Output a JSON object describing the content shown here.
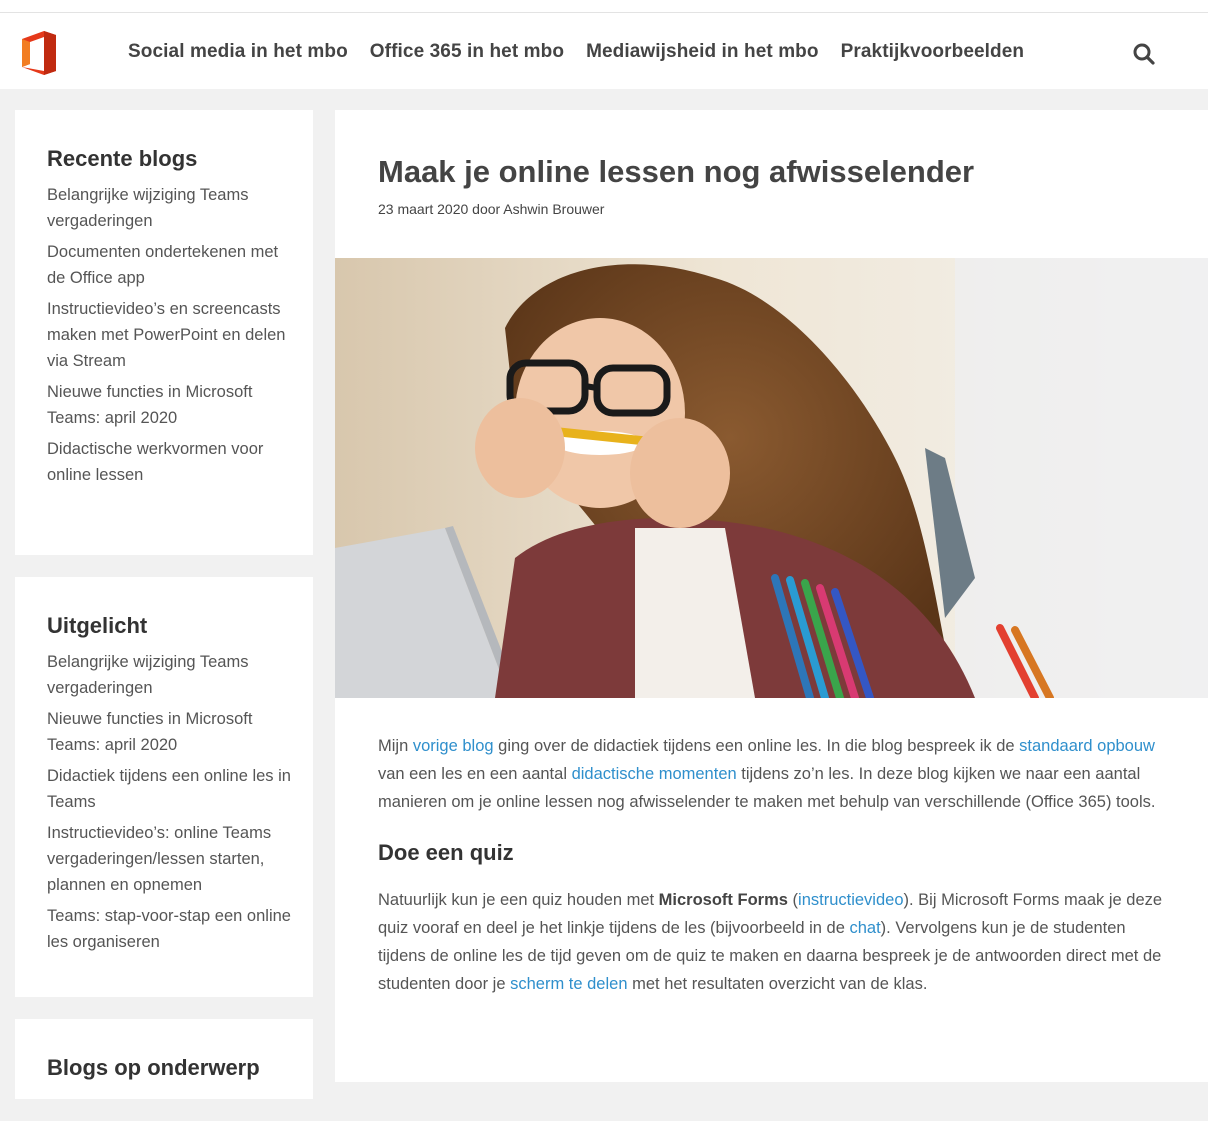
{
  "header": {
    "nav": [
      "Social media in het mbo",
      "Office 365 in het mbo",
      "Mediawijsheid in het mbo",
      "Praktijkvoorbeelden"
    ]
  },
  "sidebar": {
    "recent": {
      "title": "Recente blogs",
      "items": [
        "Belangrijke wijziging Teams vergaderingen",
        "Documenten ondertekenen met de Office app",
        "Instructievideo’s en screencasts maken met PowerPoint en delen via Stream",
        "Nieuwe functies in Microsoft Teams: april 2020",
        "Didactische werkvormen voor online lessen"
      ]
    },
    "featured": {
      "title": "Uitgelicht",
      "items": [
        "Belangrijke wijziging Teams vergaderingen",
        "Nieuwe functies in Microsoft Teams: april 2020",
        "Didactiek tijdens een online les in Teams",
        "Instructievideo’s: online Teams vergaderingen/lessen starten, plannen en opnemen",
        "Teams: stap-voor-stap een online les organiseren"
      ]
    },
    "topics": {
      "title": "Blogs op onderwerp"
    }
  },
  "post": {
    "title": "Maak je online lessen nog afwisselender",
    "meta": "23 maart 2020 door Ashwin Brouwer",
    "p1": {
      "t1": "Mijn ",
      "l1": "vorige blog",
      "t2": " ging over de didactiek tijdens een online les. In die blog bespreek ik de ",
      "l2": "standaard opbouw",
      "t3": " van een les en een aantal ",
      "l3": "didactische momenten",
      "t4": " tijdens zo’n les. In deze blog kijken we naar een aantal manieren om je online lessen nog afwisselender te maken met behulp van verschillende (Office 365) tools."
    },
    "h2": "Doe een quiz",
    "p2": {
      "t1": "Natuurlijk kun je een quiz houden met ",
      "b1": "Microsoft Forms",
      "t2": " (",
      "l1": "instructievideo",
      "t3": "). Bij Microsoft Forms maak je deze quiz vooraf en deel je het linkje tijdens de les (bijvoorbeeld in de ",
      "l2": "chat",
      "t4": "). Vervolgens kun je de studenten tijdens de online les de tijd geven om de quiz te maken en daarna bespreek je de antwoorden direct met de studenten door je ",
      "l3": "scherm te delen",
      "t5": " met het resultaten overzicht van de klas."
    }
  },
  "colors": {
    "link": "#2f8fcc",
    "office_red": "#e5391a",
    "office_orange": "#f27d22"
  },
  "icons": {
    "logo": "office-logo-icon",
    "search": "search-icon"
  }
}
